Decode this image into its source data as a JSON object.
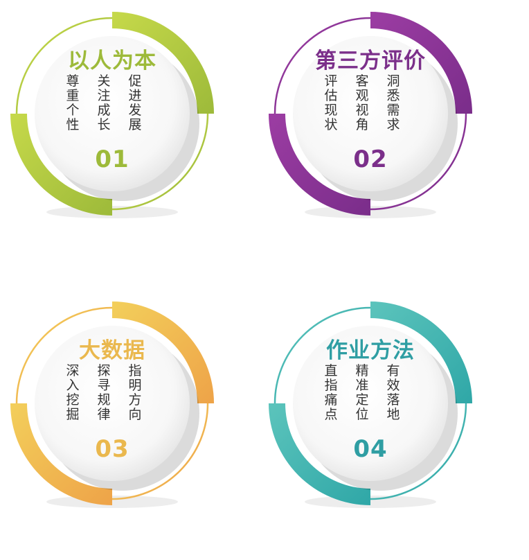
{
  "items": [
    {
      "title": "以人为本",
      "col1": "尊重个性",
      "col2": "关注成长",
      "col3": "促进发展",
      "number": "01",
      "colors": {
        "light": "#c6d94a",
        "dark": "#9dba3a",
        "text": "#9dba3a"
      }
    },
    {
      "title": "第三方评价",
      "col1": "评估现状",
      "col2": "客观视角",
      "col3": "洞悉需求",
      "number": "02",
      "colors": {
        "light": "#9c3da3",
        "dark": "#7a2d8a",
        "text": "#7b2f8a"
      }
    },
    {
      "title": "大数据",
      "col1": "深入挖掘",
      "col2": "探寻规律",
      "col3": "指明方向",
      "number": "03",
      "colors": {
        "light": "#f3cf5b",
        "dark": "#eea348",
        "text": "#eab84e"
      }
    },
    {
      "title": "作业方法",
      "col1": "直指痛点",
      "col2": "精准定位",
      "col3": "有效落地",
      "number": "04",
      "colors": {
        "light": "#5cc4bc",
        "dark": "#2fa7a7",
        "text": "#2f9ea3"
      }
    }
  ]
}
